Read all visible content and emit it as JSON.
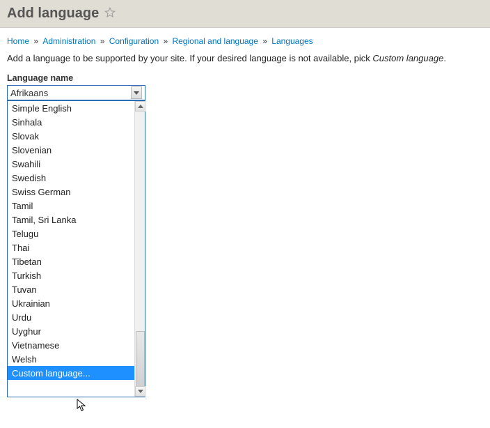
{
  "header": {
    "title": "Add language"
  },
  "breadcrumb": {
    "items": [
      "Home",
      "Administration",
      "Configuration",
      "Regional and language",
      "Languages"
    ],
    "sep": "»"
  },
  "desc": {
    "text_a": "Add a language to be supported by your site. If your desired language is not available, pick ",
    "italic": "Custom language",
    "text_b": "."
  },
  "form": {
    "label": "Language name",
    "selected": "Afrikaans"
  },
  "options": [
    "Simple English",
    "Sinhala",
    "Slovak",
    "Slovenian",
    "Swahili",
    "Swedish",
    "Swiss German",
    "Tamil",
    "Tamil, Sri Lanka",
    "Telugu",
    "Thai",
    "Tibetan",
    "Turkish",
    "Tuvan",
    "Ukrainian",
    "Urdu",
    "Uyghur",
    "Vietnamese",
    "Welsh",
    "Custom language..."
  ],
  "highlight_index": 19
}
